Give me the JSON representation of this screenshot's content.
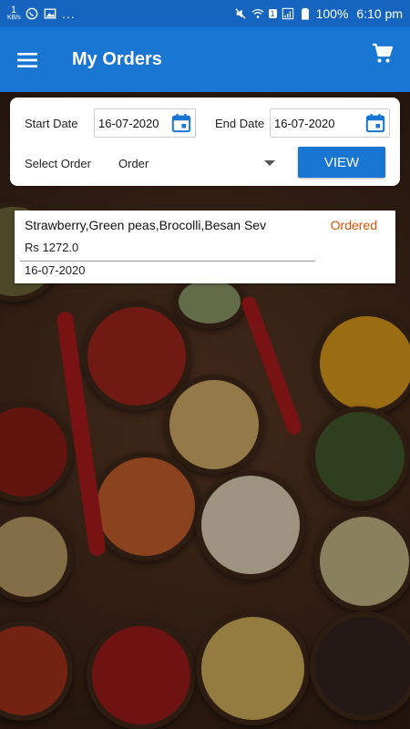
{
  "status_bar": {
    "kbs_value": "1",
    "kbs_unit": "KB/s",
    "notif_dots": "...",
    "sim_badge": "1",
    "battery": "100%",
    "time": "6:10 pm"
  },
  "app_bar": {
    "title": "My Orders",
    "menu_icon": "hamburger-menu-icon",
    "cart_icon": "shopping-cart-icon"
  },
  "filter": {
    "start_label": "Start Date",
    "start_value": "16-07-2020",
    "end_label": "End Date",
    "end_value": "16-07-2020",
    "select_label": "Select Order",
    "select_value": "Order",
    "view_button": "VIEW"
  },
  "orders": [
    {
      "items": "Strawberry,Green peas,Brocolli,Besan Sev",
      "status": "Ordered",
      "amount": "Rs 1272.0",
      "date": "16-07-2020"
    }
  ],
  "colors": {
    "primary": "#1976d2",
    "status_bar": "#1565c0",
    "status_ordered": "#e65100"
  }
}
